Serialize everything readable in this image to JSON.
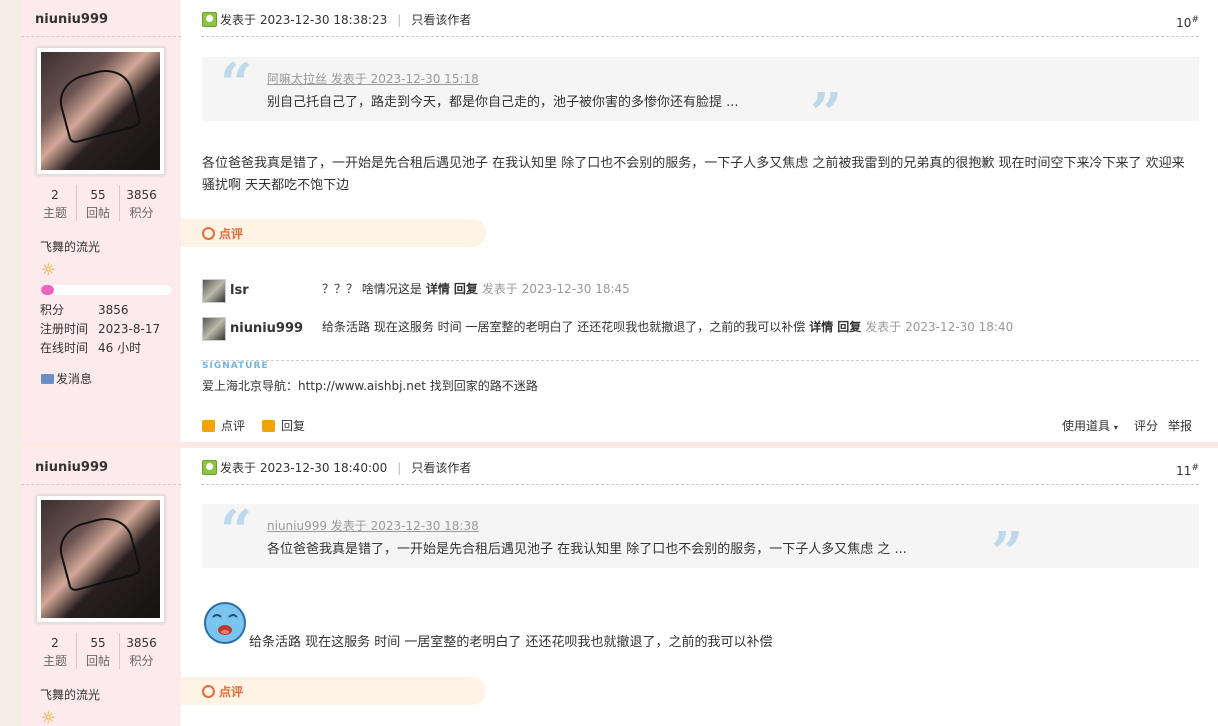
{
  "posts": [
    {
      "author": "niuniu999",
      "stats": [
        {
          "n": "2",
          "l": "主题"
        },
        {
          "n": "55",
          "l": "回帖"
        },
        {
          "n": "3856",
          "l": "积分"
        }
      ],
      "group": "飞舞的流光",
      "level_fraction": 0.1,
      "info": [
        {
          "k": "积分",
          "v": "3856"
        },
        {
          "k": "注册时间",
          "v": "2023-8-17"
        },
        {
          "k": "在线时间",
          "v": "46 小时"
        }
      ],
      "send_msg": "发消息",
      "posted": "发表于 2023-12-30 18:38:23",
      "only_author": "只看该作者",
      "floor": "10",
      "floor_sup": "#",
      "quote_author": "阿嘛太拉丝 发表于 2023-12-30 15:18",
      "quote_text": "别自己托自己了，路走到今天，都是你自己走的，池子被你害的多惨你还有脸提 ...",
      "body": "各位爸爸我真是错了，一开始是先合租后遇见池子 在我认知里 除了口也不会别的服务，一下子人多又焦虑 之前被我雷到的兄弟真的很抱歉 现在时间空下来冷下来了 欢迎来骚扰啊 天天都吃不饱下边",
      "rate_label": "点评",
      "comments": [
        {
          "name": "lsr",
          "text": "？？？  啥情况这是",
          "detail": "详情",
          "reply": "回复",
          "date": "发表于 2023-12-30 18:45"
        },
        {
          "name": "niuniu999",
          "text": "给条活路 现在这服务 时间 一居室整的老明白了 还还花呗我也就撤退了，之前的我可以补偿",
          "detail": "详情",
          "reply": "回复",
          "date": "发表于 2023-12-30 18:40"
        }
      ],
      "signature_label": "SIGNATURE",
      "signature": "爱上海北京导航：http://www.aishbj.net 找到回家的路不迷路",
      "actions": {
        "rate": "点评",
        "reply": "回复",
        "tools": "使用道具",
        "score": "评分",
        "report": "举报"
      }
    },
    {
      "author": "niuniu999",
      "stats": [
        {
          "n": "2",
          "l": "主题"
        },
        {
          "n": "55",
          "l": "回帖"
        },
        {
          "n": "3856",
          "l": "积分"
        }
      ],
      "group": "飞舞的流光",
      "posted": "发表于 2023-12-30 18:40:00",
      "only_author": "只看该作者",
      "floor": "11",
      "floor_sup": "#",
      "quote_author": "niuniu999 发表于 2023-12-30 18:38",
      "quote_text": "各位爸爸我真是错了，一开始是先合租后遇见池子 在我认知里 除了口也不会别的服务，一下子人多又焦虑 之 ...",
      "body": "给条活路 现在这服务 时间 一居室整的老明白了 还还花呗我也就撤退了，之前的我可以补偿",
      "rate_label": "点评"
    }
  ],
  "colors": {
    "sidebar": "#fdeaec",
    "quote_mark": "#bfd9ea",
    "rate": "#e86c3c",
    "level_bar": "#ef63c0"
  }
}
